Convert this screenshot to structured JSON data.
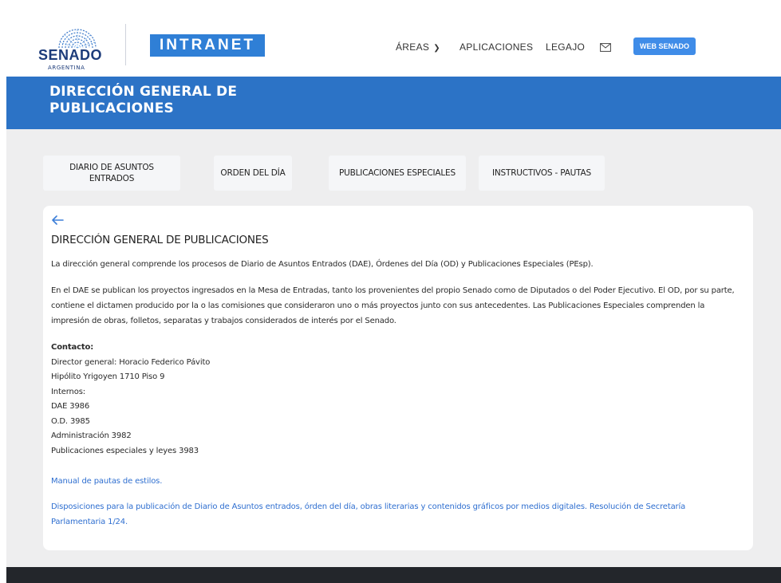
{
  "header": {
    "logo": {
      "name": "SENADO",
      "country": "ARGENTINA",
      "icon": "senado-dome-logo"
    },
    "intranet_badge": "INTRANET",
    "nav": {
      "areas": "ÁREAS",
      "aplicaciones": "APLICACIONES",
      "legajo": "LEGAJO",
      "mail_icon": "mail-icon",
      "web_senado": "WEB SENADO"
    }
  },
  "banner": {
    "title": "DIRECCIÓN GENERAL DE PUBLICACIONES"
  },
  "tabs": [
    {
      "label": "DIARIO DE ASUNTOS ENTRADOS"
    },
    {
      "label": "ORDEN DEL DÍA"
    },
    {
      "label": "PUBLICACIONES ESPECIALES"
    },
    {
      "label": "INSTRUCTIVOS - PAUTAS"
    }
  ],
  "content": {
    "back_icon": "arrow-left-icon",
    "title": "DIRECCIÓN GENERAL DE PUBLICACIONES",
    "intro": "La dirección general comprende los procesos de Diario de Asuntos Entrados (DAE), Órdenes del Día (OD) y Publicaciones Especiales (PEsp).",
    "description": "En el DAE se publican los proyectos ingresados en la Mesa de Entradas, tanto los provenientes del propio Senado como de Diputados o del Poder Ejecutivo. El OD, por su parte, contiene el dictamen producido por la o las comisiones que consideraron uno o más proyectos junto con sus antecedentes. Las Publicaciones Especiales comprenden la impresión de obras, folletos, separatas y trabajos considerados de interés por el Senado.",
    "contact": {
      "heading": "Contacto:",
      "lines": [
        "Director general: Horacio Federico Pávito",
        "Hipólito Yrigoyen 1710 Piso 9",
        "Internos:",
        "DAE 3986",
        "O.D. 3985",
        "Administración 3982",
        "Publicaciones especiales y leyes 3983"
      ]
    },
    "links": [
      "Manual de pautas de estilos.",
      "Disposiciones para la publicación de Diario de Asuntos entrados, órden del día, obras literarias y contenidos gráficos por medios digitales. Resolución de Secretaría Parlamentaria 1/24."
    ]
  },
  "colors": {
    "brand_blue": "#2c73c6",
    "intranet_blue": "#2f7fd6",
    "link_blue": "#2f6fd0",
    "footer": "#23262b",
    "page_bg": "#eeeeef"
  }
}
